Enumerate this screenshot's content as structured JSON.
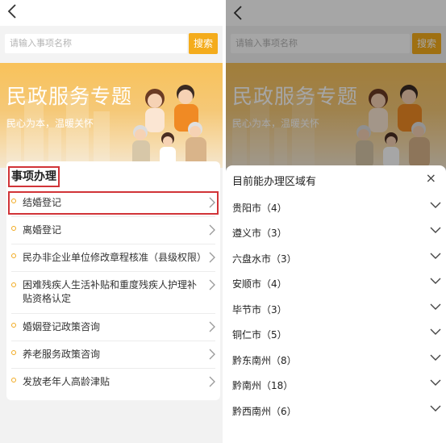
{
  "left_screen": {
    "search": {
      "placeholder": "请输入事项名称",
      "button": "搜索"
    },
    "banner": {
      "title": "民政服务专题",
      "subtitle": "民心为本，温暖关怀"
    },
    "section_title": "事项办理",
    "items": [
      {
        "label": "结婚登记"
      },
      {
        "label": "离婚登记"
      },
      {
        "label": "民办非企业单位修改章程核准（县级权限）"
      },
      {
        "label": "困难残疾人生活补贴和重度残疾人护理补贴资格认定"
      },
      {
        "label": "婚姻登记政策咨询"
      },
      {
        "label": "养老服务政策咨询"
      },
      {
        "label": "发放老年人高龄津贴"
      }
    ]
  },
  "right_screen": {
    "search": {
      "placeholder": "请输入事项名称",
      "button": "搜索"
    },
    "banner": {
      "title": "民政服务专题",
      "subtitle": "民心为本，温暖关怀"
    },
    "sheet": {
      "title": "目前能办理区域有",
      "close": "×",
      "regions": [
        {
          "name": "贵阳市",
          "count": "（4）"
        },
        {
          "name": "遵义市",
          "count": "（3）"
        },
        {
          "name": "六盘水市",
          "count": "（3）"
        },
        {
          "name": "安顺市",
          "count": "（4）"
        },
        {
          "name": "毕节市",
          "count": "（3）"
        },
        {
          "name": "铜仁市",
          "count": "（5）"
        },
        {
          "name": "黔东南州",
          "count": "（8）"
        },
        {
          "name": "黔南州",
          "count": "（18）"
        },
        {
          "name": "黔西南州",
          "count": "（6）"
        }
      ]
    }
  },
  "colors": {
    "accent": "#f4ac1c",
    "highlight": "#d13438"
  },
  "icons": {
    "back": "chevron-left-icon",
    "item_arrow": "chevron-right-icon",
    "region_arrow": "chevron-down-icon",
    "bullet": "circle-dot-icon"
  }
}
